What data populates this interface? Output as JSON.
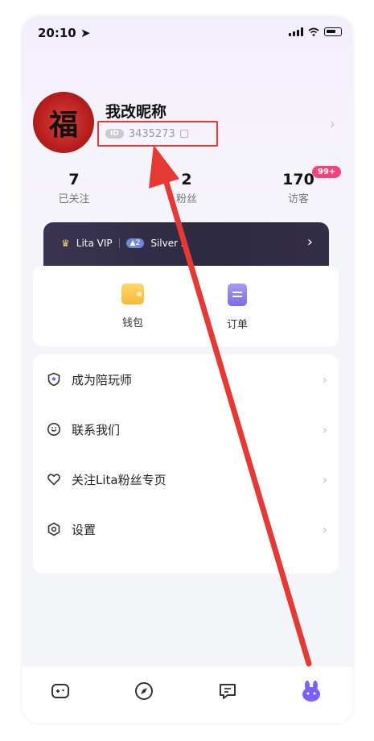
{
  "status": {
    "time": "20:10 ➤"
  },
  "profile": {
    "avatar_char": "福",
    "nickname": "我改昵称",
    "id_tag": "ID",
    "id_value": "3435273"
  },
  "stats": [
    {
      "value": "7",
      "label": "已关注"
    },
    {
      "value": "2",
      "label": "粉丝"
    },
    {
      "value": "170",
      "label": "访客",
      "badge": "99+"
    }
  ],
  "vip": {
    "brand": "Lita VIP",
    "level_num": "2",
    "level_text": "Silver 2",
    "chevron": "›"
  },
  "quick_actions": [
    {
      "label": "钱包",
      "icon": "wallet-icon"
    },
    {
      "label": "订单",
      "icon": "order-icon"
    }
  ],
  "menu": [
    {
      "label": "成为陪玩师",
      "icon": "shield-icon"
    },
    {
      "label": "联系我们",
      "icon": "support-icon"
    },
    {
      "label": "关注Lita粉丝专页",
      "icon": "heart-icon"
    },
    {
      "label": "设置",
      "icon": "gear-icon"
    }
  ],
  "tabs": [
    {
      "icon": "game-icon"
    },
    {
      "icon": "compass-icon"
    },
    {
      "icon": "message-icon"
    },
    {
      "icon": "profile-bunny-icon",
      "active": true
    }
  ],
  "colors": {
    "accent": "#7b61ff",
    "badge": "#f0457a",
    "highlight": "#e53935"
  }
}
